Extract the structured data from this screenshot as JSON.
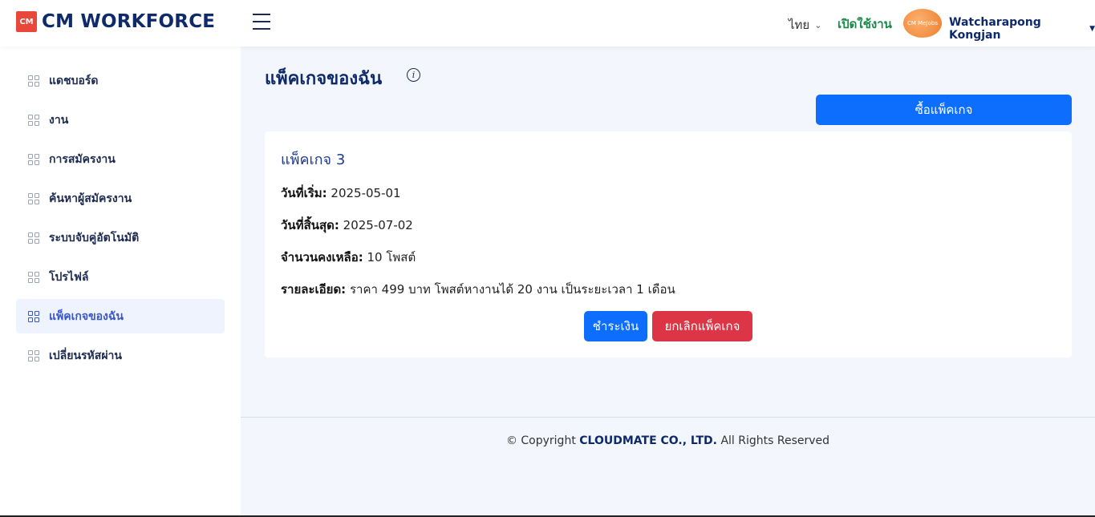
{
  "header": {
    "logo_badge": "CM",
    "logo_text": "CM WORKFORCE",
    "language": "ไทย",
    "status": "เปิดใช้งาน",
    "avatar_text": "CM MeJobs",
    "username": "Watcharapong Kongjan"
  },
  "sidebar": {
    "items": [
      {
        "label": "แดชบอร์ด"
      },
      {
        "label": "งาน"
      },
      {
        "label": "การสมัครงาน"
      },
      {
        "label": "ค้นหาผู้สมัครงาน"
      },
      {
        "label": "ระบบจับคู่อัตโนมัติ"
      },
      {
        "label": "โปรไฟล์"
      },
      {
        "label": "แพ็คเกจของฉัน"
      },
      {
        "label": "เปลี่ยนรหัสผ่าน"
      }
    ],
    "active_index": 6
  },
  "main": {
    "title": "แพ็คเกจของฉัน",
    "buy_button": "ซื้อแพ็คเกจ",
    "package": {
      "name": "แพ็คเกจ 3",
      "start_label": "วันที่เริ่ม:",
      "start_value": "2025-05-01",
      "end_label": "วันที่สิ้นสุด:",
      "end_value": "2025-07-02",
      "remaining_label": "จำนวนคงเหลือ:",
      "remaining_value": "10 โพสต์",
      "detail_label": "รายละเอียด:",
      "detail_value": "ราคา 499 บาท โพสต์หางานได้ 20 งาน เป็นระยะเวลา 1 เดือน",
      "pay_button": "ชำระเงิน",
      "cancel_button": "ยกเลิกแพ็คเกจ"
    }
  },
  "footer": {
    "prefix": "© Copyright",
    "company": "CLOUDMATE CO., LTD.",
    "suffix": "All Rights Reserved"
  }
}
